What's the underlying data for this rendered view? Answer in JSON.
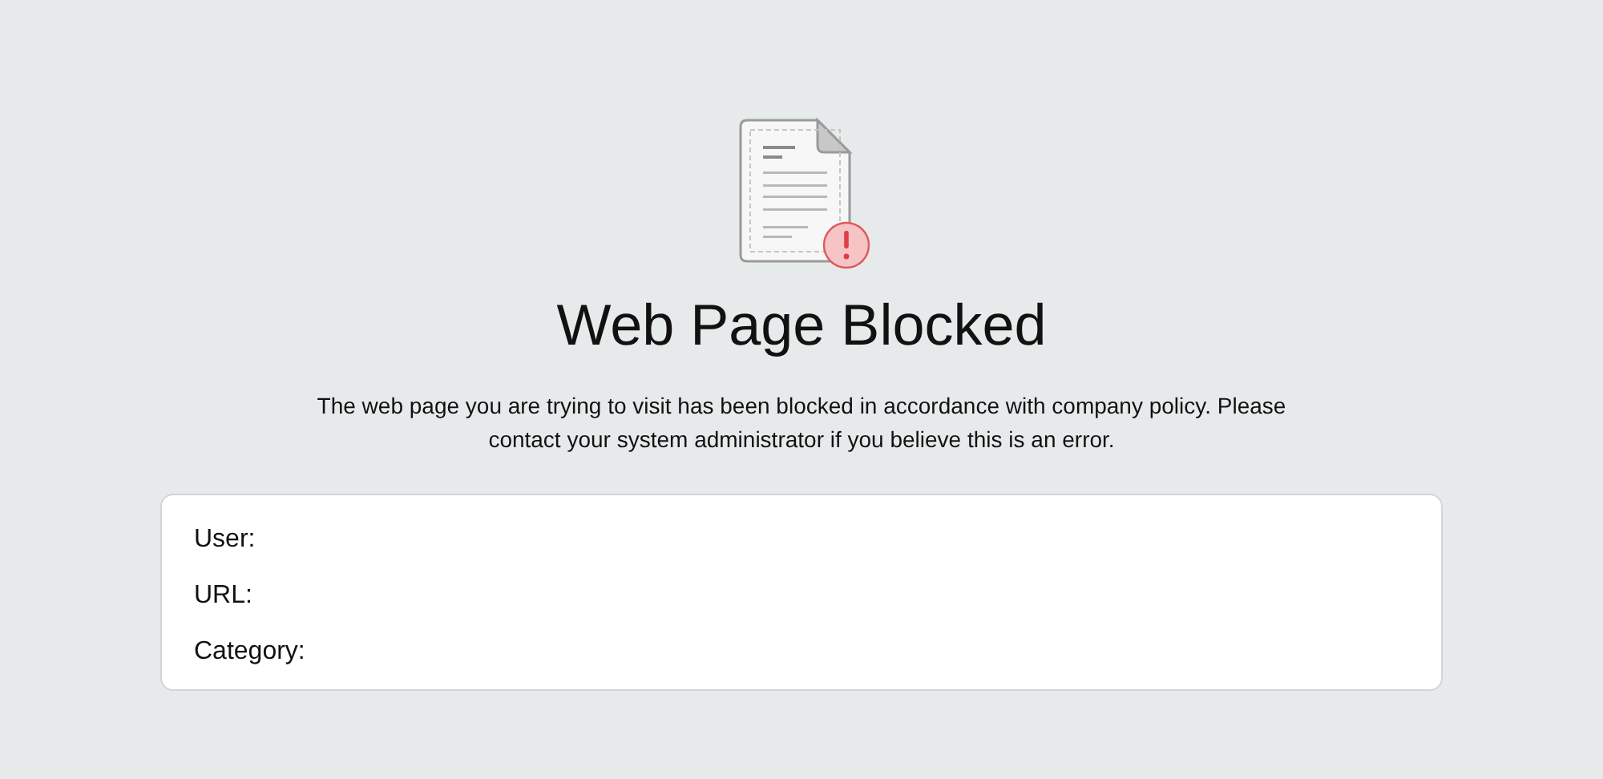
{
  "title": "Web Page Blocked",
  "message": "The web page you are trying to visit has been blocked in accordance with company policy. Please contact your system administrator if you believe this is an error.",
  "details": [
    {
      "label": "User:"
    },
    {
      "label": "URL:"
    },
    {
      "label": "Category:"
    }
  ]
}
